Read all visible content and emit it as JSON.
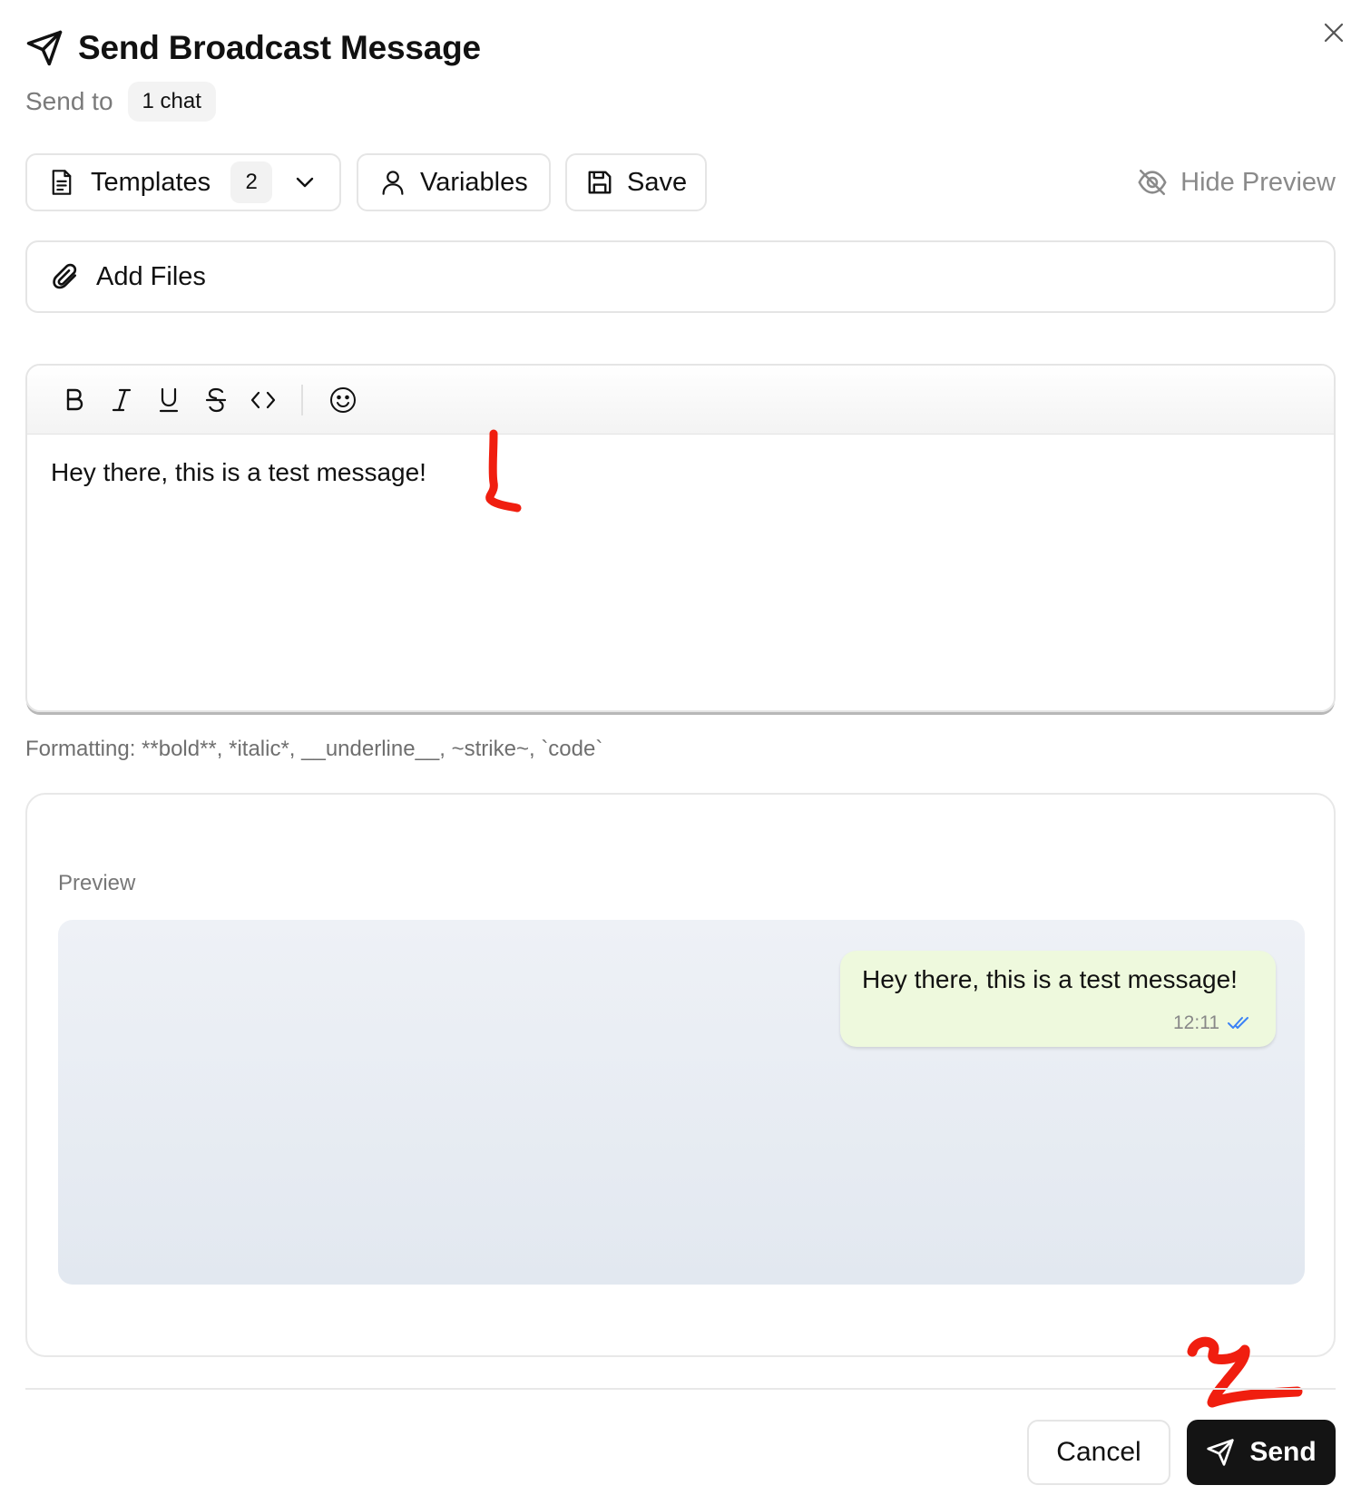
{
  "dialog": {
    "title": "Send Broadcast Message",
    "send_to_label": "Send to",
    "recipients_chip": "1 chat"
  },
  "toolbar": {
    "templates_label": "Templates",
    "templates_count": "2",
    "variables_label": "Variables",
    "save_label": "Save",
    "hide_preview_label": "Hide Preview"
  },
  "attachments": {
    "add_files_label": "Add Files"
  },
  "editor": {
    "format_buttons": [
      "bold-icon",
      "italic-icon",
      "underline-icon",
      "strikethrough-icon",
      "code-icon",
      "emoji-icon"
    ],
    "message": "Hey there, this is a test message!",
    "formatting_hint": "Formatting: **bold**, *italic*, __underline__, ~strike~, `code`"
  },
  "preview": {
    "label": "Preview",
    "bubble_text": "Hey there, this is a test message!",
    "bubble_time": "12:11",
    "bubble_status_icon": "double-check-icon"
  },
  "annotations": {
    "marker_1": "1",
    "marker_2": "2",
    "color": "#f01e0f"
  },
  "footer": {
    "cancel_label": "Cancel",
    "send_label": "Send"
  },
  "colors": {
    "bubble_bg": "#eef9dd",
    "send_button_bg": "#141414",
    "check_blue": "#3b82f6"
  }
}
